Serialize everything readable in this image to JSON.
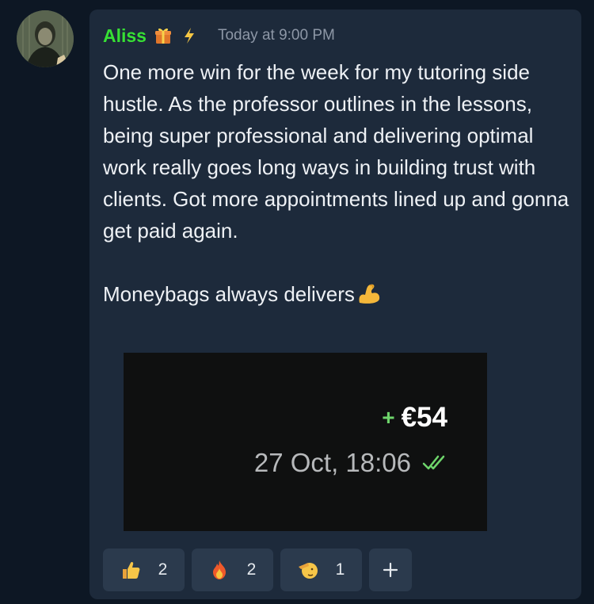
{
  "message": {
    "author": "Aliss",
    "author_color": "#37e034",
    "badges": [
      "gift-icon",
      "lightning-bolt-icon"
    ],
    "timestamp": "Today at 9:00 PM",
    "paragraphs": [
      "One more win for the week for my tutoring side hustle. As the professor outlines in the lessons, being super professional and delivering optimal work really goes long ways in building trust with clients. Got more appointments lined up and gonna get paid again.",
      "Moneybags always delivers"
    ],
    "trailing_emoji": "flexed-biceps-emoji"
  },
  "attachment": {
    "amount_sign": "+",
    "amount": "€54",
    "date": "27 Oct, 18:06",
    "status_icon": "double-check-icon",
    "amount_sign_color": "#6ed56b"
  },
  "reactions": [
    {
      "emoji": "thumbs-up-emoji",
      "count": "2"
    },
    {
      "emoji": "fire-emoji",
      "count": "2"
    },
    {
      "emoji": "saluting-face-emoji",
      "count": "1"
    }
  ],
  "add_reaction_icon": "plus-icon"
}
